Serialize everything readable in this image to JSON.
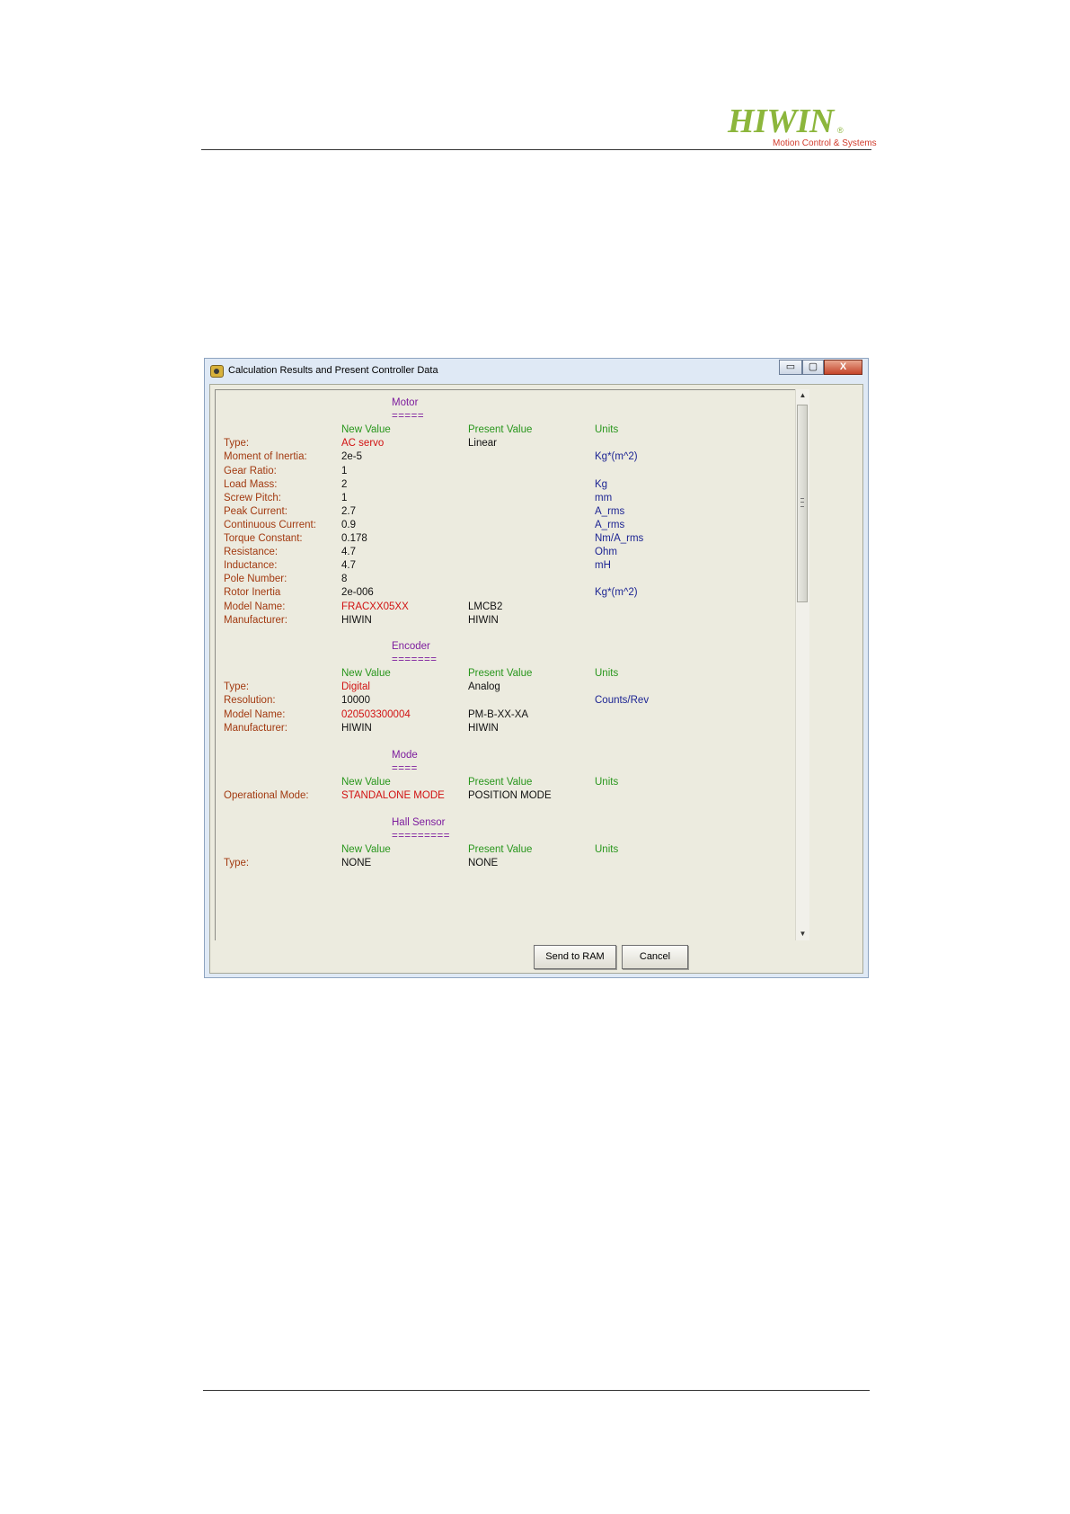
{
  "header": {
    "logo_text": "HIWIN",
    "logo_reg": "®",
    "logo_tagline": "Motion Control & Systems"
  },
  "window": {
    "title": "Calculation Results and Present Controller Data",
    "controls": {
      "minimize": "▭",
      "maximize": "▢",
      "close": "X"
    }
  },
  "columns": {
    "new": "New Value",
    "present": "Present Value",
    "units": "Units"
  },
  "motor": {
    "title": "Motor",
    "underline": "=====",
    "rows": [
      {
        "label": "Type:",
        "new": "AC servo",
        "present": "Linear",
        "unit": ""
      },
      {
        "label": "Moment of Inertia:",
        "new": "2e-5",
        "present": "",
        "unit": "Kg*(m^2)"
      },
      {
        "label": "Gear Ratio:",
        "new": "1",
        "present": "",
        "unit": ""
      },
      {
        "label": "Load Mass:",
        "new": "2",
        "present": "",
        "unit": "Kg"
      },
      {
        "label": "Screw Pitch:",
        "new": "1",
        "present": "",
        "unit": "mm"
      },
      {
        "label": "Peak Current:",
        "new": "2.7",
        "present": "",
        "unit": "A_rms"
      },
      {
        "label": "Continuous Current:",
        "new": "0.9",
        "present": "",
        "unit": "A_rms"
      },
      {
        "label": "Torque Constant:",
        "new": "0.178",
        "present": "",
        "unit": "Nm/A_rms"
      },
      {
        "label": "Resistance:",
        "new": "4.7",
        "present": "",
        "unit": "Ohm"
      },
      {
        "label": "Inductance:",
        "new": "4.7",
        "present": "",
        "unit": "mH"
      },
      {
        "label": "Pole Number:",
        "new": "8",
        "present": "",
        "unit": ""
      },
      {
        "label": "Rotor Inertia",
        "new": "2e-006",
        "present": "",
        "unit": "Kg*(m^2)"
      },
      {
        "label": "Model Name:",
        "new": "FRACXX05XX",
        "present": "LMCB2",
        "unit": ""
      },
      {
        "label": "Manufacturer:",
        "new": "HIWIN",
        "present": "HIWIN",
        "unit": ""
      }
    ]
  },
  "encoder": {
    "title": "Encoder",
    "underline": "=======",
    "rows": [
      {
        "label": "Type:",
        "new": "Digital",
        "present": "Analog",
        "unit": ""
      },
      {
        "label": "Resolution:",
        "new": "10000",
        "present": "",
        "unit": "Counts/Rev"
      },
      {
        "label": "Model Name:",
        "new": "020503300004",
        "present": "PM-B-XX-XA",
        "unit": ""
      },
      {
        "label": "Manufacturer:",
        "new": "HIWIN",
        "present": "HIWIN",
        "unit": ""
      }
    ]
  },
  "mode": {
    "title": "Mode",
    "underline": "====",
    "rows": [
      {
        "label": "Operational Mode:",
        "new": "STANDALONE MODE",
        "present": "POSITION MODE",
        "unit": ""
      }
    ]
  },
  "hall": {
    "title": "Hall Sensor",
    "underline": "=========",
    "rows": [
      {
        "label": "Type:",
        "new": "NONE",
        "present": "NONE",
        "unit": ""
      }
    ]
  },
  "buttons": {
    "send": "Send to RAM",
    "cancel": "Cancel"
  },
  "scrollbar": {
    "up": "▲",
    "down": "▼"
  },
  "colors": {
    "label": "#a23a11",
    "header": "#28961c",
    "section": "#7d1d9e",
    "changed": "#d11212",
    "unit": "#1c2493",
    "logo": "#8cb63c",
    "tagline": "#d13a2b"
  }
}
